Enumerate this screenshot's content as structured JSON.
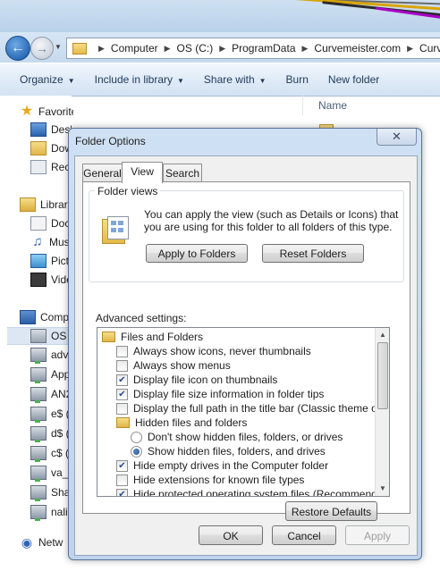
{
  "explorer": {
    "breadcrumbs": [
      "Computer",
      "OS (C:)",
      "ProgramData",
      "Curvemeister.com",
      "Curve"
    ],
    "commands": [
      {
        "label": "Organize",
        "has_caret": true
      },
      {
        "label": "Include in library",
        "has_caret": true
      },
      {
        "label": "Share with",
        "has_caret": true
      },
      {
        "label": "Burn",
        "has_caret": false
      },
      {
        "label": "New folder",
        "has_caret": false
      }
    ],
    "nav": {
      "favorites": "Favorites",
      "desktop": "Desk",
      "downloads": "Dow",
      "recent": "Rece",
      "libraries": "Librar",
      "documents": "Docu",
      "music": "Musi",
      "pictures": "Pictu",
      "videos": "Vide",
      "computer": "Comp",
      "os": "OS (",
      "drives": [
        "adv",
        "App",
        "AN2",
        "e$ (",
        "d$ (",
        "c$ (",
        "va_c",
        "Sha",
        "nali"
      ],
      "network": "Netw"
    },
    "content_header": "Name"
  },
  "dialog": {
    "title": "Folder Options",
    "close_glyph": "✕",
    "tabs": [
      "General",
      "View",
      "Search"
    ],
    "active_tab": "View",
    "folder_views": {
      "legend": "Folder views",
      "description": "You can apply the view (such as Details or Icons) that you are using for this folder to all folders of this type.",
      "apply_button": "Apply to Folders",
      "reset_button": "Reset Folders"
    },
    "advanced_label": "Advanced settings:",
    "advanced_items": [
      {
        "kind": "folder",
        "label": "Files and Folders"
      },
      {
        "kind": "checkbox",
        "checked": false,
        "label": "Always show icons, never thumbnails"
      },
      {
        "kind": "checkbox",
        "checked": false,
        "label": "Always show menus"
      },
      {
        "kind": "checkbox",
        "checked": true,
        "label": "Display file icon on thumbnails"
      },
      {
        "kind": "checkbox",
        "checked": true,
        "label": "Display file size information in folder tips"
      },
      {
        "kind": "checkbox",
        "checked": false,
        "label": "Display the full path in the title bar (Classic theme only)"
      },
      {
        "kind": "folder",
        "label": "Hidden files and folders"
      },
      {
        "kind": "radio",
        "checked": false,
        "label": "Don't show hidden files, folders, or drives"
      },
      {
        "kind": "radio",
        "checked": true,
        "label": "Show hidden files, folders, and drives"
      },
      {
        "kind": "checkbox",
        "checked": true,
        "label": "Hide empty drives in the Computer folder"
      },
      {
        "kind": "checkbox",
        "checked": false,
        "label": "Hide extensions for known file types"
      },
      {
        "kind": "checkbox",
        "checked": true,
        "label": "Hide protected operating system files (Recommended)"
      }
    ],
    "restore_button": "Restore Defaults",
    "ok_button": "OK",
    "cancel_button": "Cancel",
    "apply_button": "Apply"
  }
}
